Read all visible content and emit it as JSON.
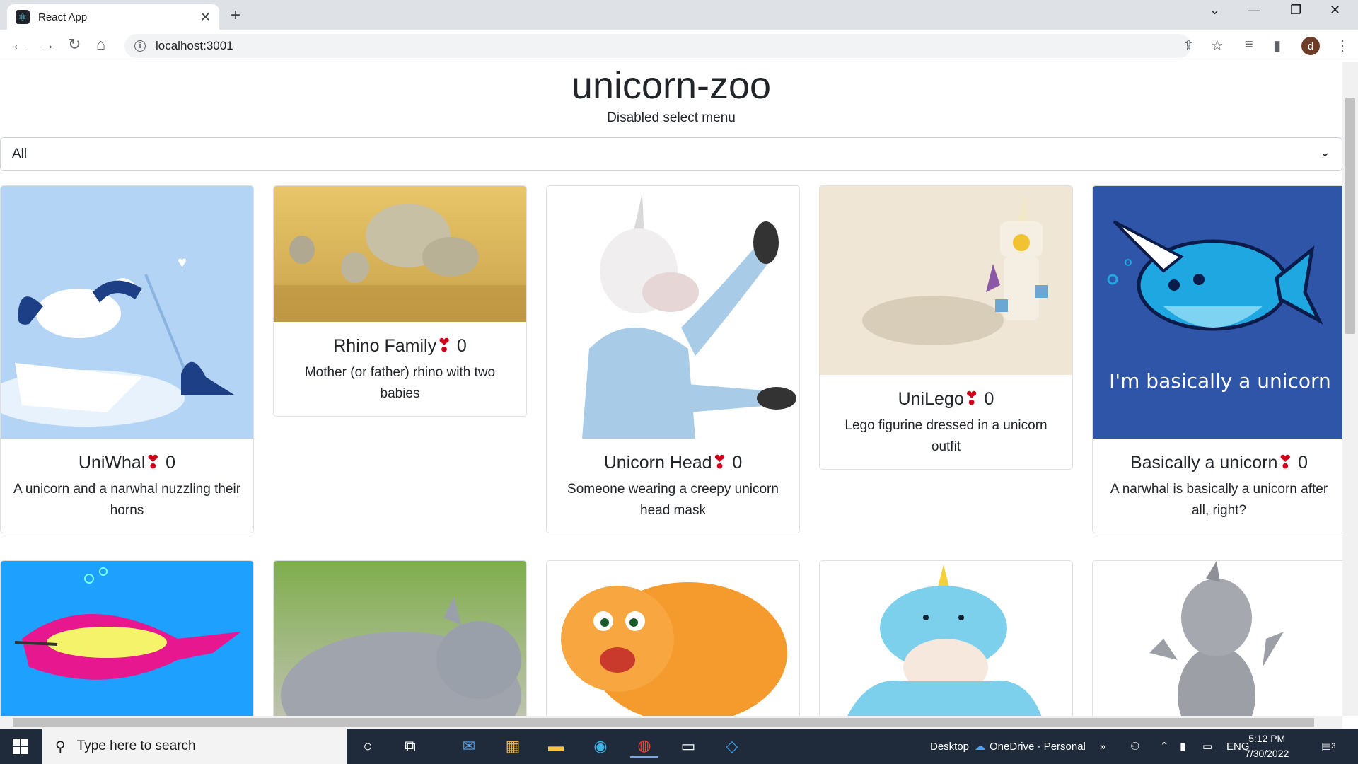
{
  "browser": {
    "tab_title": "React App",
    "url": "localhost:3001"
  },
  "page": {
    "title": "unicorn-zoo",
    "subtitle": "Disabled select menu",
    "select_value": "All"
  },
  "cards": [
    {
      "name": "UniWhal",
      "votes": "0",
      "desc": "A unicorn and a narwhal nuzzling their horns"
    },
    {
      "name": "Rhino Family",
      "votes": "0",
      "desc": "Mother (or father) rhino with two babies"
    },
    {
      "name": "Unicorn Head",
      "votes": "0",
      "desc": "Someone wearing a creepy unicorn head mask"
    },
    {
      "name": "UniLego",
      "votes": "0",
      "desc": "Lego figurine dressed in a unicorn outfit"
    },
    {
      "name": "Basically a unicorn",
      "votes": "0",
      "desc": "A narwhal is basically a unicorn after all, right?",
      "image_caption": "I'm basically a unicorn"
    }
  ],
  "taskbar": {
    "search_placeholder": "Type here to search",
    "desktop_label": "Desktop",
    "onedrive_label": "OneDrive - Personal",
    "lang": "ENG",
    "time": "5:12 PM",
    "date": "7/30/2022",
    "notif_count": "3"
  },
  "colors": {
    "heart": "#d0021b",
    "taskbar": "#1f2b3a"
  }
}
